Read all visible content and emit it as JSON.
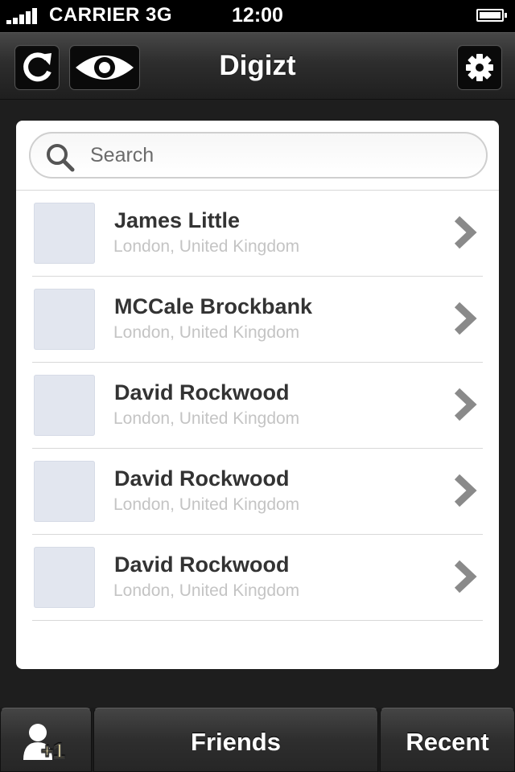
{
  "status_bar": {
    "carrier": "CARRIER",
    "network": "3G",
    "time": "12:00"
  },
  "nav": {
    "title": "Digizt",
    "left_icons": [
      "refresh-icon",
      "eye-icon"
    ],
    "right_icon": "gear-icon"
  },
  "search": {
    "placeholder": "Search",
    "value": ""
  },
  "contacts": [
    {
      "name": "James Little",
      "location": "London, United Kingdom"
    },
    {
      "name": "MCCale Brockbank",
      "location": "London, United Kingdom"
    },
    {
      "name": "David Rockwood",
      "location": "London, United Kingdom"
    },
    {
      "name": "David Rockwood",
      "location": "London, United Kingdom"
    },
    {
      "name": "David Rockwood",
      "location": "London, United Kingdom"
    }
  ],
  "tab_bar": {
    "add_badge": "+1",
    "friends_label": "Friends",
    "recent_label": "Recent"
  },
  "colors": {
    "nav_background": "#2d2d2d",
    "card_background": "#ffffff",
    "name_text": "#333333",
    "location_text": "#c4c4c4",
    "avatar_placeholder": "#e2e6ef"
  }
}
